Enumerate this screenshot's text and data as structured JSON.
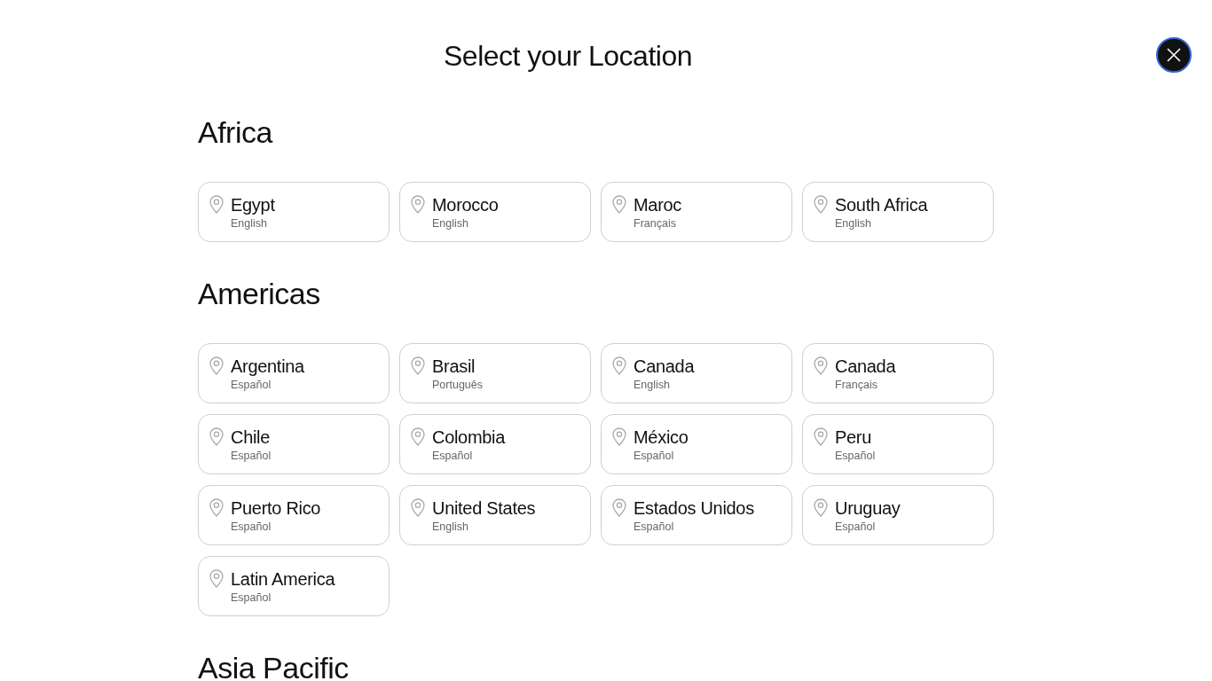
{
  "title": "Select your Location",
  "regions": [
    {
      "name": "Africa",
      "locations": [
        {
          "country": "Egypt",
          "language": "English"
        },
        {
          "country": "Morocco",
          "language": "English"
        },
        {
          "country": "Maroc",
          "language": "Français"
        },
        {
          "country": "South Africa",
          "language": "English"
        }
      ]
    },
    {
      "name": "Americas",
      "locations": [
        {
          "country": "Argentina",
          "language": "Español"
        },
        {
          "country": "Brasil",
          "language": "Português"
        },
        {
          "country": "Canada",
          "language": "English"
        },
        {
          "country": "Canada",
          "language": "Français"
        },
        {
          "country": "Chile",
          "language": "Español"
        },
        {
          "country": "Colombia",
          "language": "Español"
        },
        {
          "country": "México",
          "language": "Español"
        },
        {
          "country": "Peru",
          "language": "Español"
        },
        {
          "country": "Puerto Rico",
          "language": "Español"
        },
        {
          "country": "United States",
          "language": "English"
        },
        {
          "country": "Estados Unidos",
          "language": "Español"
        },
        {
          "country": "Uruguay",
          "language": "Español"
        },
        {
          "country": "Latin America",
          "language": "Español"
        }
      ]
    },
    {
      "name": "Asia Pacific"
    }
  ]
}
